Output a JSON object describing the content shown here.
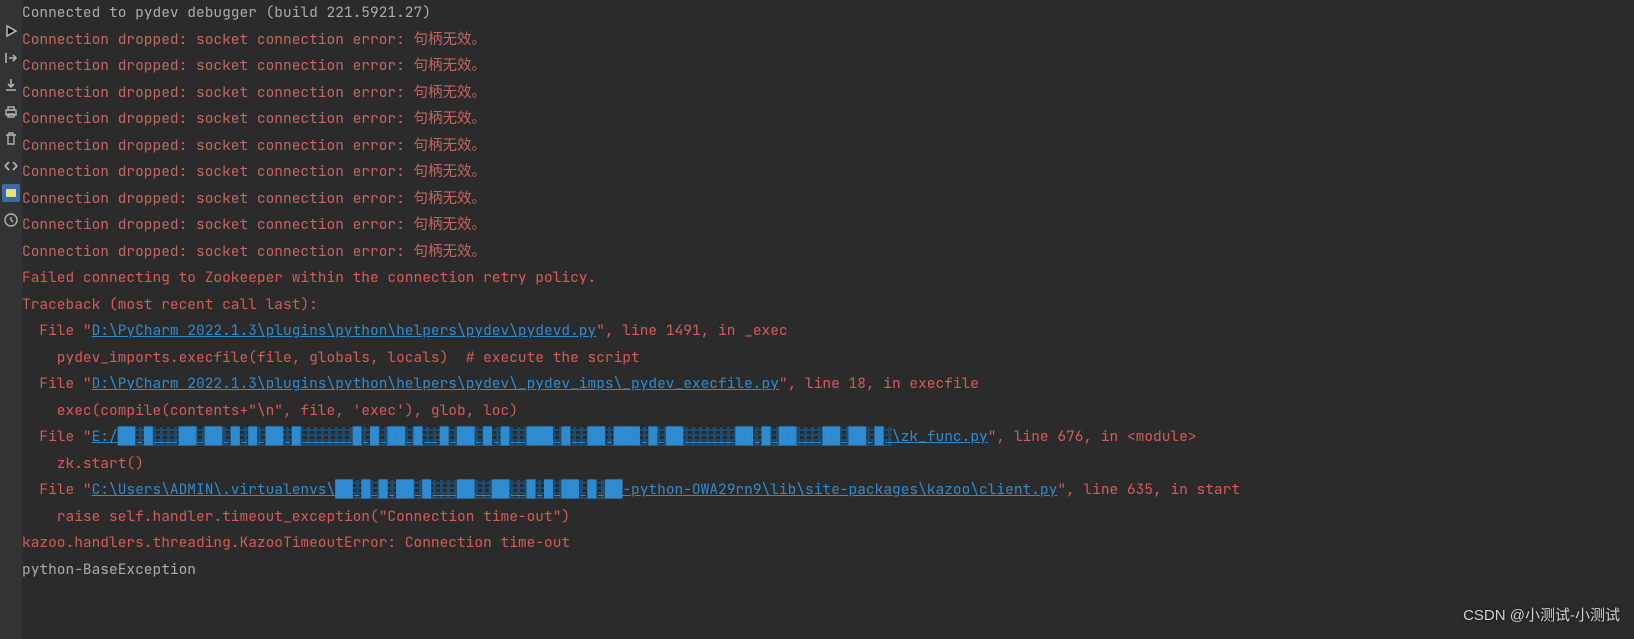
{
  "gutter": {
    "icons": [
      "play",
      "arrow-right",
      "download",
      "print",
      "trash",
      "angles",
      "highlight",
      "clock"
    ]
  },
  "lines": [
    {
      "segs": [
        {
          "cls": "c-gray",
          "t": "Connected to pydev debugger (build 221.5921.27)"
        }
      ]
    },
    {
      "segs": [
        {
          "cls": "c-errTx",
          "t": "Connection dropped: socket connection error: 句柄无效。"
        }
      ]
    },
    {
      "segs": [
        {
          "cls": "c-errTx",
          "t": "Connection dropped: socket connection error: 句柄无效。"
        }
      ]
    },
    {
      "segs": [
        {
          "cls": "c-errTx",
          "t": "Connection dropped: socket connection error: 句柄无效。"
        }
      ]
    },
    {
      "segs": [
        {
          "cls": "c-errTx",
          "t": "Connection dropped: socket connection error: 句柄无效。"
        }
      ]
    },
    {
      "segs": [
        {
          "cls": "c-errTx",
          "t": "Connection dropped: socket connection error: 句柄无效。"
        }
      ]
    },
    {
      "segs": [
        {
          "cls": "c-errTx",
          "t": "Connection dropped: socket connection error: 句柄无效。"
        }
      ]
    },
    {
      "segs": [
        {
          "cls": "c-errTx",
          "t": "Connection dropped: socket connection error: 句柄无效。"
        }
      ]
    },
    {
      "segs": [
        {
          "cls": "c-errTx",
          "t": "Connection dropped: socket connection error: 句柄无效。"
        }
      ]
    },
    {
      "segs": [
        {
          "cls": "c-errTx",
          "t": "Connection dropped: socket connection error: 句柄无效。"
        }
      ]
    },
    {
      "segs": [
        {
          "cls": "c-err",
          "t": "Failed connecting to Zookeeper within the connection retry policy."
        }
      ]
    },
    {
      "segs": [
        {
          "cls": "c-err",
          "t": "Traceback (most recent call last):"
        }
      ]
    },
    {
      "segs": [
        {
          "cls": "c-err",
          "t": "  File \""
        },
        {
          "cls": "c-link",
          "t": "D:\\PyCharm 2022.1.3\\plugins\\python\\helpers\\pydev\\pydevd.py"
        },
        {
          "cls": "c-err",
          "t": "\", line 1491, in _exec"
        }
      ]
    },
    {
      "segs": [
        {
          "cls": "c-err",
          "t": "    pydev_imports.execfile(file, globals, locals)  # execute the script"
        }
      ]
    },
    {
      "segs": [
        {
          "cls": "c-err",
          "t": "  File \""
        },
        {
          "cls": "c-link",
          "t": "D:\\PyCharm 2022.1.3\\plugins\\python\\helpers\\pydev\\_pydev_imps\\_pydev_execfile.py"
        },
        {
          "cls": "c-err",
          "t": "\", line 18, in execfile"
        }
      ]
    },
    {
      "segs": [
        {
          "cls": "c-err",
          "t": "    exec(compile(contents+\"\\n\", file, 'exec'), glob, loc)"
        }
      ]
    },
    {
      "segs": [
        {
          "cls": "c-err",
          "t": "  File \""
        },
        {
          "cls": "c-link",
          "t": "E:/"
        },
        {
          "cls": "c-obsc",
          "t": "██ █   ██ ██ █ █ ██ █      █ █ ██ █  █ ██ █ █  ███ █  ██ ███ █ ██      ██ █ ██   ██ ██ █ "
        },
        {
          "cls": "c-link",
          "t": "\\zk_func.py"
        },
        {
          "cls": "c-err",
          "t": "\", line 676, in <module>"
        }
      ]
    },
    {
      "segs": [
        {
          "cls": "c-err",
          "t": "    zk.start()"
        }
      ]
    },
    {
      "segs": [
        {
          "cls": "c-err",
          "t": "  File \""
        },
        {
          "cls": "c-link",
          "t": "C:\\Users\\ADMIN\\.virtualenvs\\"
        },
        {
          "cls": "c-obsc",
          "t": "██ █ █ ██ █   ██  ██  █ █ ██ █ ██"
        },
        {
          "cls": "c-link",
          "t": "-python-OWA29rn9\\lib\\site-packages\\kazoo\\client.py"
        },
        {
          "cls": "c-err",
          "t": "\", line 635, in start"
        }
      ]
    },
    {
      "segs": [
        {
          "cls": "c-err",
          "t": "    raise self.handler.timeout_exception(\"Connection time-out\")"
        }
      ]
    },
    {
      "segs": [
        {
          "cls": "c-err",
          "t": "kazoo.handlers.threading.KazooTimeoutError: Connection time-out"
        }
      ]
    },
    {
      "segs": [
        {
          "cls": "c-gray",
          "t": "python-BaseException"
        }
      ]
    }
  ],
  "attribution": "CSDN @小测试-小测试"
}
